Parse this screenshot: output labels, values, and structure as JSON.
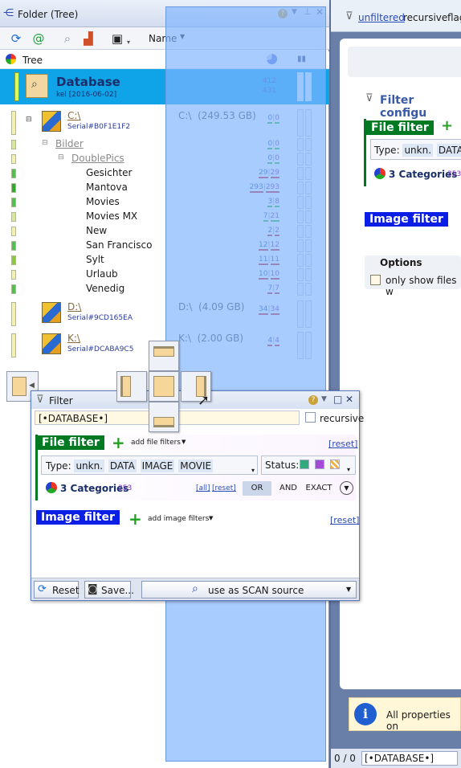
{
  "colors": {
    "database_row": "#0fa3e8",
    "file_filter_bg": "#007a22",
    "image_filter_bg": "#0a1ee6",
    "link": "#2a4bb8",
    "dock_overlay": "#80b4ff"
  },
  "left_panel": {
    "title": "Folder (Tree)",
    "toolbar": {
      "sort_label": "Name"
    },
    "tree_header": "Tree",
    "database": {
      "title": "Database",
      "subtitle": "kel [2016-06-02]",
      "count_a": "412",
      "count_b": "431"
    },
    "items": [
      {
        "name": "C:\\",
        "serial": "Serial#B0F1E1F2",
        "drive_info": "C:\\  (249.53 GB)",
        "a": "0",
        "b": "0",
        "level": 0
      },
      {
        "name": "Bilder",
        "a": "0",
        "b": "0",
        "level": 1
      },
      {
        "name": "DoublePics",
        "a": "0",
        "b": "0",
        "level": 2
      },
      {
        "name": "Gesichter",
        "a": "29",
        "b": "29",
        "level": 3
      },
      {
        "name": "Mantova",
        "a": "293",
        "b": "293",
        "level": 3
      },
      {
        "name": "Movies",
        "a": "3",
        "b": "8",
        "level": 3
      },
      {
        "name": "Movies MX",
        "a": "7",
        "b": "21",
        "level": 3
      },
      {
        "name": "New",
        "a": "2",
        "b": "2",
        "level": 3
      },
      {
        "name": "San Francisco",
        "a": "12",
        "b": "12",
        "level": 3
      },
      {
        "name": "Sylt",
        "a": "11",
        "b": "11",
        "level": 3
      },
      {
        "name": "Urlaub",
        "a": "10",
        "b": "10",
        "level": 3
      },
      {
        "name": "Venedig",
        "a": "7",
        "b": "7",
        "level": 3
      },
      {
        "name": "D:\\",
        "serial": "Serial#9CD165EA",
        "drive_info": "D:\\  (4.09 GB)",
        "a": "34",
        "b": "34",
        "level": 0
      },
      {
        "name": "K:\\",
        "serial": "Serial#DCABA9C5",
        "drive_info": "K:\\  (2.00 GB)",
        "a": "4",
        "b": "4",
        "level": 0
      }
    ]
  },
  "right_panel": {
    "tab_unfiltered": "unfiltered",
    "tab_recursive": "recursive",
    "tab_flag": "flag",
    "filter_config_title": "Filter configu",
    "file_filter": "File filter",
    "type_label": "Type:",
    "types": [
      "unkn.",
      "DATA",
      "I"
    ],
    "categories": "3 Categories",
    "categories_count": "353",
    "image_filter": "Image filter",
    "options_title": "Options",
    "only_show": "only show files w",
    "info_text": "All properties on",
    "status_page": "0 / 0",
    "status_db": "[•DATABASE•]"
  },
  "filter_window": {
    "title": "Filter",
    "source": "[•DATABASE•]",
    "recursive": "recursive",
    "file_filter": "File filter",
    "add_file_filters": "add file filters",
    "reset": "[reset]",
    "type_label": "Type:",
    "types": [
      "unkn.",
      "DATA",
      "IMAGE",
      "MOVIE"
    ],
    "status_label": "Status:",
    "categories": "3 Categories",
    "categories_count": "353",
    "all_link": "[all]",
    "reset_link": "[reset]",
    "logic_or": "OR",
    "logic_and": "AND",
    "logic_exact": "EXACT",
    "image_filter": "Image filter",
    "add_image_filters": "add image filters",
    "image_reset": "[reset]",
    "reset_button": "Reset",
    "save_button": "Save...",
    "scan_source": "use as SCAN source"
  }
}
